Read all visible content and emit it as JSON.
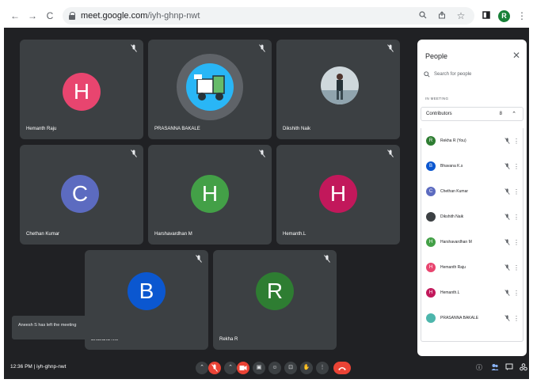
{
  "browser": {
    "back": "←",
    "forward": "→",
    "reload": "C",
    "url_host": "meet.google.com",
    "url_path": "/iyh-ghnp-nwt",
    "profile_initial": "R"
  },
  "tiles": [
    {
      "name": "Hemanth Raju",
      "initial": "H",
      "color": "#e8456f"
    },
    {
      "name": "PRASANNA BAKALE",
      "initial": "",
      "color": "#5f6368"
    },
    {
      "name": "Dikshith Naik",
      "initial": "",
      "color": "#5f6368"
    },
    {
      "name": "Chethan Kumar",
      "initial": "C",
      "color": "#5c6bc0"
    },
    {
      "name": "Harshavardhan M",
      "initial": "H",
      "color": "#43a047"
    },
    {
      "name": "Hemanth.L",
      "initial": "H",
      "color": "#c2185b"
    },
    {
      "name": "Bhavana K.s",
      "initial": "B",
      "color": "#0b57d0"
    },
    {
      "name": "Rekha R",
      "initial": "R",
      "color": "#2e7d32"
    }
  ],
  "panel": {
    "title": "People",
    "close": "✕",
    "search_placeholder": "Search for people",
    "section": "IN MEETING",
    "group_label": "Contributors",
    "group_count": "8",
    "group_caret": "⌃",
    "participants": [
      {
        "name": "Rekha R (You)",
        "initial": "R",
        "color": "#2e7d32"
      },
      {
        "name": "Bhavana K.s",
        "initial": "B",
        "color": "#0b57d0"
      },
      {
        "name": "Chethan Kumar",
        "initial": "C",
        "color": "#5c6bc0"
      },
      {
        "name": "Dikshith Naik",
        "initial": "",
        "color": "#3c4043"
      },
      {
        "name": "Harshavardhan M",
        "initial": "H",
        "color": "#43a047"
      },
      {
        "name": "Hemanth Raju",
        "initial": "H",
        "color": "#e8456f"
      },
      {
        "name": "Hemanth.L",
        "initial": "H",
        "color": "#c2185b"
      },
      {
        "name": "PRASANNA BAKALE",
        "initial": "",
        "color": "#4db6ac"
      }
    ]
  },
  "toast": "Aneesh S has left the meeting",
  "bottom": {
    "time": "12:36 PM",
    "separator": "|",
    "meeting_code": "iyh-ghnp-nwt"
  },
  "colors": {
    "stage": "#202124",
    "tile": "#3c4043",
    "end_call": "#ea4335"
  }
}
